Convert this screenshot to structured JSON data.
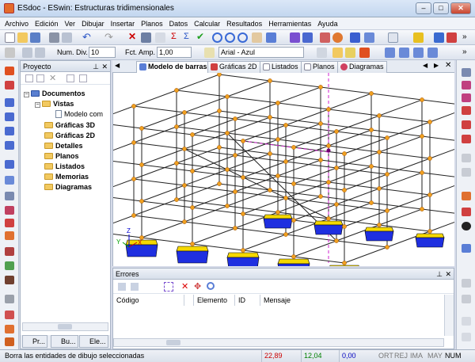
{
  "window": {
    "title": "ESdoc - ESwin: Estructuras tridimensionales"
  },
  "menu": [
    "Archivo",
    "Edición",
    "Ver",
    "Dibujar",
    "Insertar",
    "Planos",
    "Datos",
    "Calcular",
    "Resultados",
    "Herramientas",
    "Ayuda"
  ],
  "toolbar2": {
    "num_div_label": "Num. Div.",
    "num_div_value": "10",
    "fct_amp_label": "Fct. Amp.",
    "fct_amp_value": "1,00",
    "font_value": "Arial - Azul"
  },
  "project": {
    "title": "Proyecto",
    "tree": {
      "root": "Documentos",
      "vistas": "Vistas",
      "modelo": "Modelo com",
      "graficas3d": "Gráficas 3D",
      "graficas2d": "Gráficas 2D",
      "detalles": "Detalles",
      "planos": "Planos",
      "listados": "Listados",
      "memorias": "Memorias",
      "diagramas": "Diagramas"
    },
    "bottom_tabs": [
      "Pr...",
      "Bu...",
      "Ele..."
    ]
  },
  "viewport_tabs": [
    "Modelo de barras",
    "Gráficas 2D",
    "Listados",
    "Planos",
    "Diagramas"
  ],
  "errors": {
    "title": "Errores",
    "columns": [
      "Código",
      "Elemento",
      "ID",
      "Mensaje"
    ]
  },
  "axis": {
    "x": "X",
    "y": "Y",
    "z": "Z"
  },
  "status": {
    "message": "Borra las entidades de dibujo seleccionadas",
    "x": "22,89",
    "y": "12,04",
    "z": "0,00",
    "flags": [
      "ORT",
      "REJ",
      "IMA",
      "MAY",
      "NUM"
    ]
  },
  "colors": {
    "beam_node": "#f0a020",
    "support": "#1f2fe0",
    "support_top": "#f5d800",
    "selection_line": "#d020d0",
    "coord_x": "#d00000",
    "coord_y": "#00a000",
    "coord_z": "#0000d0"
  }
}
